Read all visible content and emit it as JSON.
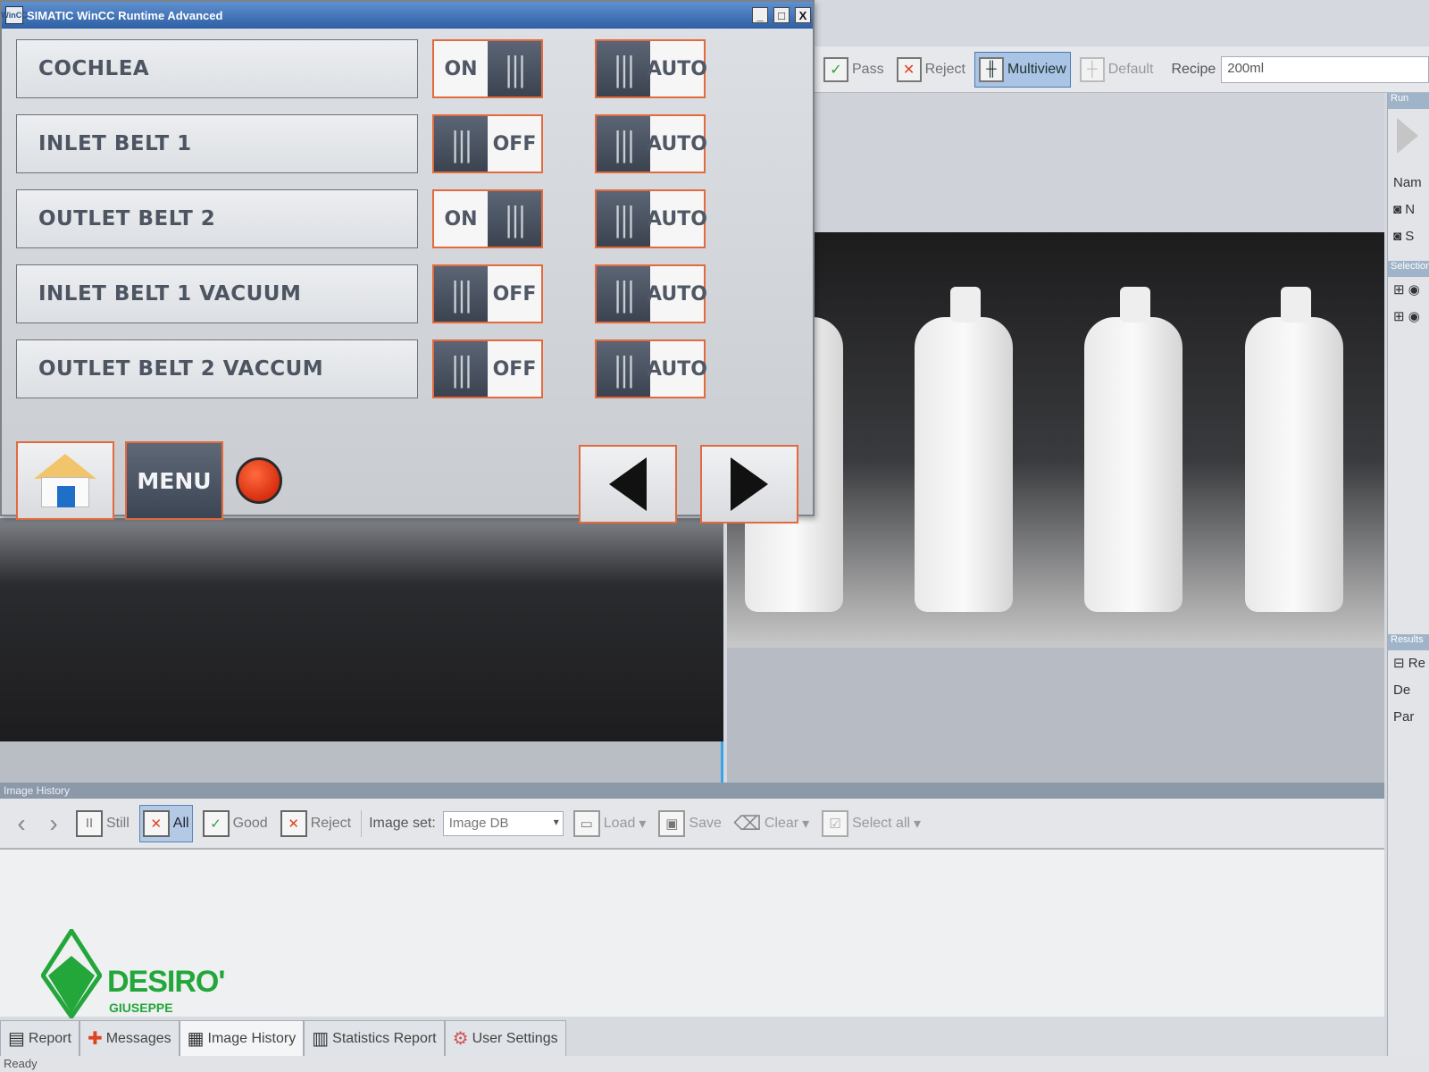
{
  "hmi": {
    "title": "SIMATIC WinCC Runtime Advanced",
    "icon_text": "WinCC",
    "window_controls": [
      "_",
      "□",
      "X"
    ],
    "rows": [
      {
        "label": "COCHLEA",
        "switch_text": "ON",
        "switch_state": "on",
        "mode_text": "AUTO"
      },
      {
        "label": "INLET BELT 1",
        "switch_text": "OFF",
        "switch_state": "off",
        "mode_text": "AUTO"
      },
      {
        "label": "OUTLET BELT 2",
        "switch_text": "ON",
        "switch_state": "on",
        "mode_text": "AUTO"
      },
      {
        "label": "INLET BELT 1 VACUUM",
        "switch_text": "OFF",
        "switch_state": "off",
        "mode_text": "AUTO"
      },
      {
        "label": "OUTLET BELT 2 VACCUM",
        "switch_text": "OFF",
        "switch_state": "off",
        "mode_text": "AUTO"
      }
    ],
    "menu_label": "MENU",
    "knob_glyph": "|||",
    "status_lamp_color": "#e03a1a",
    "accent_border": "#e36a3d",
    "icons": {
      "home": "home-icon",
      "prev": "arrow-left-icon",
      "next": "arrow-right-icon"
    }
  },
  "vision_toolbar": {
    "pass_label": "Pass",
    "reject_label": "Reject",
    "multiview_label": "Multiview",
    "default_label": "Default",
    "recipe_label": "Recipe",
    "recipe_value": "200ml"
  },
  "right_panel": {
    "run_header": "Run",
    "name_label": "Nam",
    "item1": "N",
    "item2": "S",
    "selection_header": "Selection",
    "results_header": "Results",
    "results_item": "Re",
    "results_sub1": "De",
    "results_sub2": "Par"
  },
  "image_history": {
    "title": "Image History",
    "still_label": "Still",
    "all_label": "All",
    "good_label": "Good",
    "reject_label": "Reject",
    "image_set_label": "Image set:",
    "image_set_value": "Image DB",
    "load_label": "Load",
    "save_label": "Save",
    "clear_label": "Clear",
    "select_all_label": "Select all"
  },
  "bottom_tabs": [
    {
      "label": "Report",
      "icon": "clipboard-icon"
    },
    {
      "label": "Messages",
      "icon": "messages-icon"
    },
    {
      "label": "Image History",
      "icon": "film-icon"
    },
    {
      "label": "Statistics Report",
      "icon": "bar-chart-icon"
    },
    {
      "label": "User Settings",
      "icon": "settings-icon"
    }
  ],
  "status": {
    "text": "Ready"
  },
  "logo": {
    "name": "DESIRO'",
    "sub": "GIUSEPPE"
  }
}
